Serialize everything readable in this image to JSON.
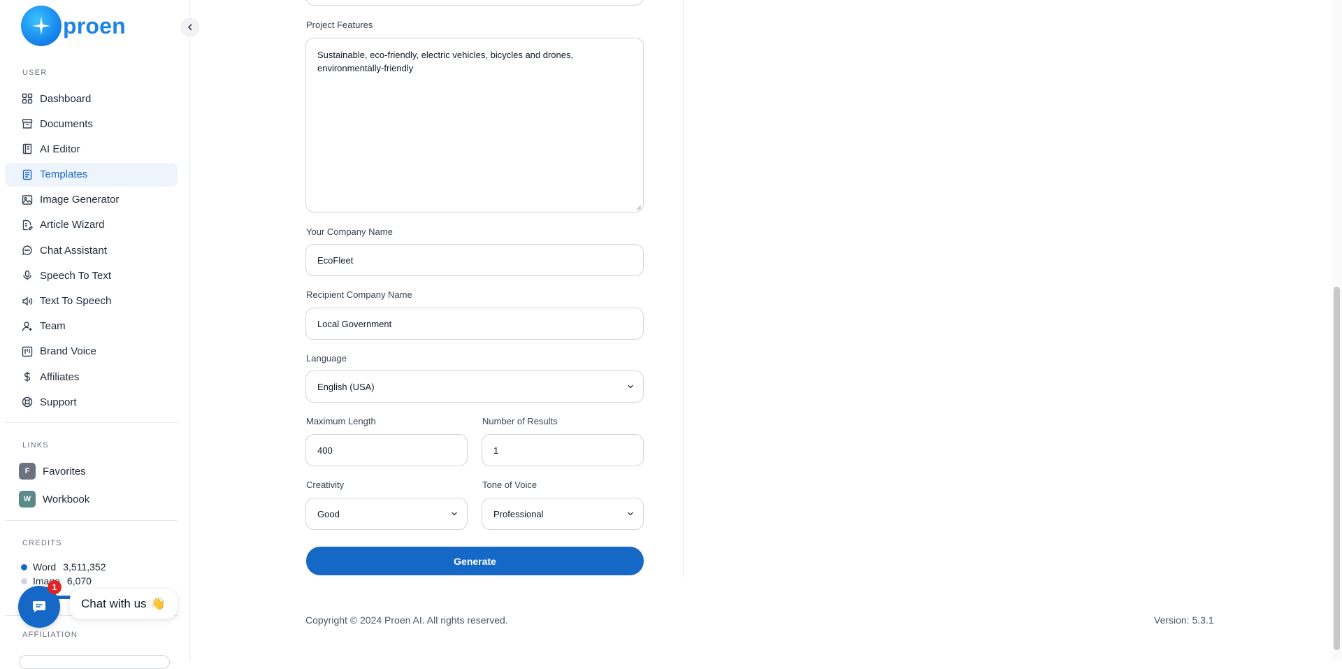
{
  "brand": {
    "name": "proen"
  },
  "sidebar": {
    "user_section": "USER",
    "items": [
      {
        "label": "Dashboard",
        "icon": "grid-icon"
      },
      {
        "label": "Documents",
        "icon": "archive-icon"
      },
      {
        "label": "AI Editor",
        "icon": "notebook-icon"
      },
      {
        "label": "Templates",
        "icon": "file-text-icon",
        "active": true
      },
      {
        "label": "Image Generator",
        "icon": "image-icon"
      },
      {
        "label": "Article Wizard",
        "icon": "file-edit-icon"
      },
      {
        "label": "Chat Assistant",
        "icon": "chat-bubble-icon"
      },
      {
        "label": "Speech To Text",
        "icon": "microphone-icon"
      },
      {
        "label": "Text To Speech",
        "icon": "speaker-icon"
      },
      {
        "label": "Team",
        "icon": "user-plus-icon"
      },
      {
        "label": "Brand Voice",
        "icon": "board-icon"
      },
      {
        "label": "Affiliates",
        "icon": "dollar-icon"
      },
      {
        "label": "Support",
        "icon": "lifebuoy-icon"
      }
    ],
    "links_section": "LINKS",
    "links": [
      {
        "badge": "F",
        "label": "Favorites",
        "color": "#6b7280"
      },
      {
        "badge": "W",
        "label": "Workbook",
        "color": "#5b8a8a"
      }
    ],
    "credits_section": "CREDITS",
    "credits": [
      {
        "label": "Word",
        "value": "3,511,352",
        "color": "#1668c7"
      },
      {
        "label": "Image",
        "value": "6,070",
        "color": "#d1d5db"
      }
    ],
    "affiliation_section": "AFFILIATION"
  },
  "chat_widget": {
    "label": "Chat with us",
    "emoji": "👋",
    "count": "1"
  },
  "form": {
    "project_features": {
      "label": "Project Features",
      "value": "Sustainable, eco-friendly, electric vehicles, bicycles and drones, environmentally-friendly"
    },
    "company_name": {
      "label": "Your Company Name",
      "value": "EcoFleet"
    },
    "recipient_company": {
      "label": "Recipient Company Name",
      "value": "Local Government"
    },
    "language": {
      "label": "Language",
      "value": "English (USA)"
    },
    "max_length": {
      "label": "Maximum Length",
      "value": "400"
    },
    "num_results": {
      "label": "Number of Results",
      "value": "1"
    },
    "creativity": {
      "label": "Creativity",
      "value": "Good"
    },
    "tone": {
      "label": "Tone of Voice",
      "value": "Professional"
    },
    "generate_label": "Generate"
  },
  "footer": {
    "copyright": "Copyright © 2024 Proen AI. All rights reserved.",
    "version": "Version: 5.3.1"
  },
  "colors": {
    "accent": "#1668c7",
    "brand": "#1b83e6",
    "notification": "#e02424"
  }
}
